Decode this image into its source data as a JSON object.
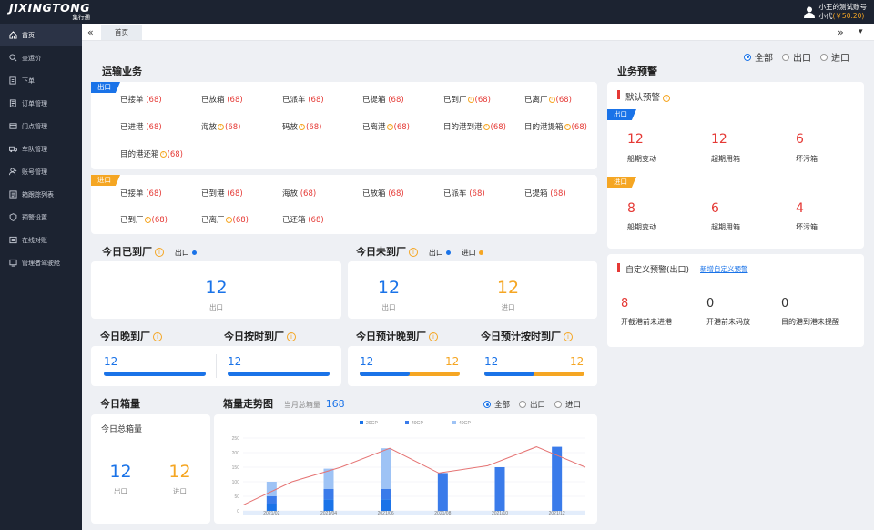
{
  "app": {
    "logo_en": "JIXINGTONG",
    "logo_cn": "集行通",
    "account_name": "小王的测试账号",
    "user_name": "小代",
    "balance": "(￥50.20)"
  },
  "sidebar": {
    "items": [
      {
        "label": "首页",
        "icon": "home-icon"
      },
      {
        "label": "查运价",
        "icon": "search-icon"
      },
      {
        "label": "下单",
        "icon": "edit-icon"
      },
      {
        "label": "订单管理",
        "icon": "document-icon"
      },
      {
        "label": "门点管理",
        "icon": "location-icon"
      },
      {
        "label": "车队管理",
        "icon": "truck-icon"
      },
      {
        "label": "账号管理",
        "icon": "users-icon"
      },
      {
        "label": "箱跟踪列表",
        "icon": "list-icon"
      },
      {
        "label": "预警设置",
        "icon": "shield-icon"
      },
      {
        "label": "在线对账",
        "icon": "reconcile-icon"
      },
      {
        "label": "管理者驾驶舱",
        "icon": "dashboard-icon"
      }
    ]
  },
  "tabbar": {
    "collapse": "«",
    "tab": "首页",
    "expand": "»",
    "menu": "▾"
  },
  "filter": {
    "options": [
      "全部",
      "出口",
      "进口"
    ],
    "selected": "全部"
  },
  "transport": {
    "title": "运输业务",
    "export_tag": "出口",
    "import_tag": "进口",
    "export_items": [
      {
        "label": "已接单",
        "count": "(68)",
        "info": false
      },
      {
        "label": "已放箱",
        "count": "(68)",
        "info": false
      },
      {
        "label": "已派车",
        "count": "(68)",
        "info": false
      },
      {
        "label": "已提箱",
        "count": "(68)",
        "info": false
      },
      {
        "label": "已到厂",
        "count": "(68)",
        "info": true
      },
      {
        "label": "已离厂",
        "count": "(68)",
        "info": true
      },
      {
        "label": "已进港",
        "count": "(68)",
        "info": false
      },
      {
        "label": "海放",
        "count": "(68)",
        "info": true
      },
      {
        "label": "码放",
        "count": "(68)",
        "info": true
      },
      {
        "label": "已离港",
        "count": "(68)",
        "info": true
      },
      {
        "label": "目的港到港",
        "count": "(68)",
        "info": true
      },
      {
        "label": "目的港提箱",
        "count": "(68)",
        "info": true
      },
      {
        "label": "目的港还箱",
        "count": "(68)",
        "info": true
      }
    ],
    "import_items": [
      {
        "label": "已接单",
        "count": "(68)",
        "info": false
      },
      {
        "label": "已到港",
        "count": "(68)",
        "info": false
      },
      {
        "label": "海放",
        "count": "(68)",
        "info": false
      },
      {
        "label": "已放箱",
        "count": "(68)",
        "info": false
      },
      {
        "label": "已派车",
        "count": "(68)",
        "info": false
      },
      {
        "label": "已提箱",
        "count": "(68)",
        "info": false
      },
      {
        "label": "已到厂",
        "count": "(68)",
        "info": true
      },
      {
        "label": "已离厂",
        "count": "(68)",
        "info": true
      },
      {
        "label": "已还箱",
        "count": "(68)",
        "info": false
      }
    ]
  },
  "today_arrived": {
    "title": "今日已到厂",
    "legend": "出口",
    "value": "12",
    "label": "出口"
  },
  "today_not_arrived": {
    "title": "今日未到厂",
    "legend_out": "出口",
    "legend_in": "进口",
    "value_out": "12",
    "label_out": "出口",
    "value_in": "12",
    "label_in": "进口"
  },
  "late": {
    "title": "今日晚到厂",
    "value": "12",
    "progress": 1.0
  },
  "ontime": {
    "title": "今日按时到厂",
    "value": "12",
    "progress": 1.0
  },
  "expected_late": {
    "title": "今日预计晚到厂",
    "value_out": "12",
    "value_in": "12",
    "out_fraction": 0.5
  },
  "expected_ontime": {
    "title": "今日预计按时到厂",
    "value_out": "12",
    "value_in": "12",
    "out_fraction": 0.5
  },
  "box_today": {
    "title": "今日箱量",
    "subtitle": "今日总箱量",
    "value_out": "12",
    "label_out": "出口",
    "value_in": "12",
    "label_in": "进口"
  },
  "trend": {
    "title": "箱量走势图",
    "month_total_label": "当月总箱量",
    "month_total": "168"
  },
  "chart_data": {
    "type": "bar",
    "categories": [
      "2021/02",
      "2021/04",
      "2021/06",
      "2021/08",
      "2021/10",
      "2021/12"
    ],
    "ylim": [
      0,
      250
    ],
    "yticks": [
      0,
      50,
      100,
      150,
      200,
      250
    ],
    "stacked": true,
    "series": [
      {
        "name": "20GP",
        "color": "#1a73e8",
        "values": [
          25,
          40,
          40,
          0,
          0,
          0
        ]
      },
      {
        "name": "40GP",
        "color": "#3a7bea",
        "values": [
          25,
          35,
          35,
          130,
          150,
          220
        ]
      },
      {
        "name": "40GP",
        "color": "#9ec3f5",
        "values": [
          50,
          70,
          140,
          0,
          0,
          0
        ]
      }
    ],
    "line": {
      "color": "#e57373",
      "x": [
        0,
        1,
        2,
        3,
        4,
        5,
        6
      ],
      "y": [
        20,
        100,
        150,
        215,
        130,
        155,
        220,
        150
      ]
    }
  },
  "business_alert": {
    "title": "业务预警",
    "default_title": "默认预警",
    "export_tag": "出口",
    "import_tag": "进口",
    "export": [
      {
        "value": "12",
        "label": "船期变动"
      },
      {
        "value": "12",
        "label": "超期用箱"
      },
      {
        "value": "6",
        "label": "坏污箱"
      }
    ],
    "import": [
      {
        "value": "8",
        "label": "船期变动"
      },
      {
        "value": "6",
        "label": "超期用箱"
      },
      {
        "value": "4",
        "label": "坏污箱"
      }
    ],
    "custom_title": "自定义预警(出口)",
    "custom_link": "新增自定义预警",
    "custom": [
      {
        "value": "8",
        "label": "开截港前未进港",
        "color": "#e53935"
      },
      {
        "value": "0",
        "label": "开港前未码放",
        "color": "#333333"
      },
      {
        "value": "0",
        "label": "目的港到港未提醒",
        "color": "#333333"
      }
    ]
  }
}
